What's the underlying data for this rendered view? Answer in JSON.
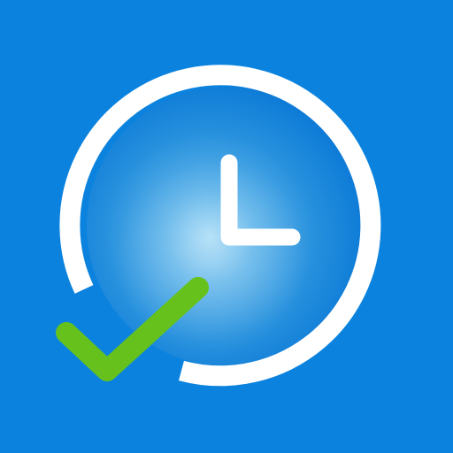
{
  "icon": {
    "name": "clock-check-app-icon",
    "depicts": [
      "clock-icon",
      "checkmark-icon"
    ]
  },
  "colors": {
    "background": "#0b83de",
    "clock_face_center": "#a9dcf6",
    "clock_face_mid": "#3f9ddf",
    "clock_face_edge": "#0a78d6",
    "ring": "#ffffff",
    "hands": "#ffffff",
    "checkmark": "#66c11d"
  }
}
